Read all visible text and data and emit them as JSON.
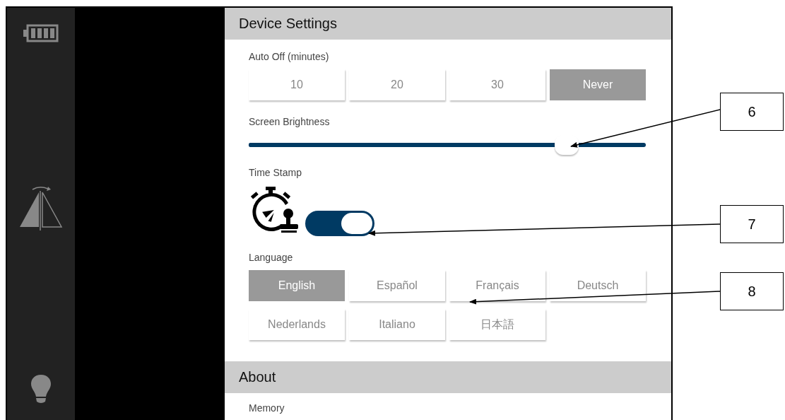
{
  "device_settings": {
    "title": "Device Settings",
    "auto_off": {
      "label": "Auto Off (minutes)",
      "options": [
        {
          "label": "10",
          "selected": false
        },
        {
          "label": "20",
          "selected": false
        },
        {
          "label": "30",
          "selected": false
        },
        {
          "label": "Never",
          "selected": true
        }
      ]
    },
    "brightness": {
      "label": "Screen Brightness",
      "level": 0.8
    },
    "time_stamp": {
      "label": "Time Stamp",
      "on": true
    },
    "language": {
      "label": "Language",
      "options": [
        {
          "label": "English",
          "selected": true
        },
        {
          "label": "Español",
          "selected": false
        },
        {
          "label": "Français",
          "selected": false
        },
        {
          "label": "Deutsch",
          "selected": false
        },
        {
          "label": "Nederlands",
          "selected": false
        },
        {
          "label": "Italiano",
          "selected": false
        },
        {
          "label": "日本語",
          "selected": false
        }
      ]
    }
  },
  "about": {
    "title": "About",
    "items": [
      {
        "label": "Memory"
      }
    ]
  },
  "callouts": [
    {
      "label": "6"
    },
    {
      "label": "7"
    },
    {
      "label": "8"
    }
  ]
}
